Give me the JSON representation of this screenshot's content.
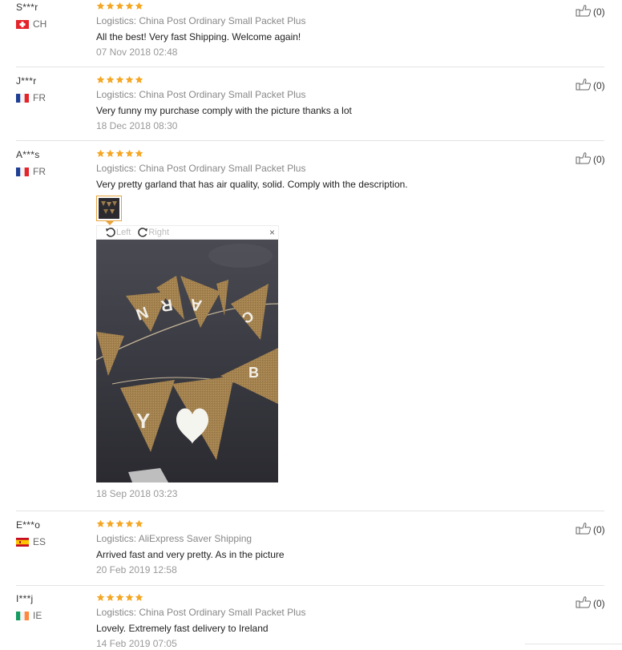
{
  "reviews": [
    {
      "name": "S***r",
      "country": "CH",
      "flag": "ch",
      "logistics": "Logistics: China Post Ordinary Small Packet Plus",
      "text": "All the best! Very fast Shipping. Welcome again!",
      "date": "07 Nov 2018 02:48",
      "useful": "(0)",
      "rating": 5
    },
    {
      "name": "J***r",
      "country": "FR",
      "flag": "fr",
      "logistics": "Logistics: China Post Ordinary Small Packet Plus",
      "text": "Very funny my purchase comply with the picture thanks a lot",
      "date": "18 Dec 2018 08:30",
      "useful": "(0)",
      "rating": 5
    },
    {
      "name": "A***s",
      "country": "FR",
      "flag": "fr",
      "logistics": "Logistics: China Post Ordinary Small Packet Plus",
      "text": "Very pretty garland that has air quality, solid. Comply with the description.",
      "date": "18 Sep 2018 03:23",
      "useful": "(0)",
      "rating": 5
    },
    {
      "name": "E***o",
      "country": "ES",
      "flag": "es",
      "logistics": "Logistics: AliExpress Saver Shipping",
      "text": "Arrived fast and very pretty. As in the picture",
      "date": "20 Feb 2019 12:58",
      "useful": "(0)",
      "rating": 5
    },
    {
      "name": "I***j",
      "country": "IE",
      "flag": "ie",
      "logistics": "Logistics: China Post Ordinary Small Packet Plus",
      "text": "Lovely. Extremely fast delivery to Ireland",
      "date": "14 Feb 2019 07:05",
      "useful": "(0)",
      "rating": 5
    }
  ],
  "viewer": {
    "left_label": "Left",
    "right_label": "Right",
    "close": "×"
  },
  "colors": {
    "star": "#f5a623",
    "thumb_border": "#e8a33c",
    "separator": "#e3e3e3"
  },
  "icons": {
    "useful": "thumbs-up-icon",
    "rotate_left": "rotate-left-icon",
    "rotate_right": "rotate-right-icon",
    "close": "close-icon",
    "star": "star-icon"
  }
}
